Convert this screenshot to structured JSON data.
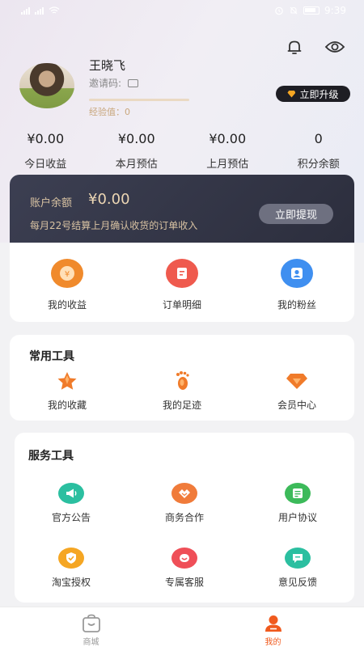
{
  "status_bar": {
    "time": "9:39"
  },
  "profile": {
    "name": "王晓飞",
    "invite_label": "邀请码:",
    "exp_label": "经验值：0",
    "exp_progress": 0,
    "upgrade_label": "立即升级"
  },
  "stats": [
    {
      "value": "¥0.00",
      "label": "今日收益"
    },
    {
      "value": "¥0.00",
      "label": "本月预估"
    },
    {
      "value": "¥0.00",
      "label": "上月预估"
    },
    {
      "value": "0",
      "label": "积分余额"
    }
  ],
  "balance": {
    "label": "账户余额",
    "amount": "¥0.00",
    "note": "每月22号结算上月确认收货的订单收入",
    "withdraw_label": "立即提现"
  },
  "quick_links": [
    {
      "label": "我的收益",
      "icon": "yuan-icon",
      "color": "#f08a2c"
    },
    {
      "label": "订单明细",
      "icon": "document-icon",
      "color": "#ef5a4e"
    },
    {
      "label": "我的粉丝",
      "icon": "user-icon",
      "color": "#3f8ff0"
    }
  ],
  "common_tools": {
    "title": "常用工具",
    "items": [
      {
        "label": "我的收藏",
        "icon": "star-icon",
        "color": "#f07b2a"
      },
      {
        "label": "我的足迹",
        "icon": "footprint-icon",
        "color": "#f07b2a"
      },
      {
        "label": "会员中心",
        "icon": "diamond-icon",
        "color": "#f07b2a"
      }
    ]
  },
  "service_tools": {
    "title": "服务工具",
    "items": [
      {
        "label": "官方公告",
        "icon": "megaphone-icon",
        "color": "#2bbfa0"
      },
      {
        "label": "商务合作",
        "icon": "handshake-icon",
        "color": "#f07b3a"
      },
      {
        "label": "用户协议",
        "icon": "agreement-icon",
        "color": "#3cba5a"
      },
      {
        "label": "淘宝授权",
        "icon": "shield-icon",
        "color": "#f5a623"
      },
      {
        "label": "专属客服",
        "icon": "service-icon",
        "color": "#ef4f58"
      },
      {
        "label": "意见反馈",
        "icon": "feedback-icon",
        "color": "#2bbfa0"
      }
    ]
  },
  "tabbar": [
    {
      "label": "商城",
      "icon": "shop-bag-icon",
      "active": false,
      "color": "#999999"
    },
    {
      "label": "我的",
      "icon": "profile-icon",
      "active": true,
      "color": "#f05a1e"
    }
  ]
}
